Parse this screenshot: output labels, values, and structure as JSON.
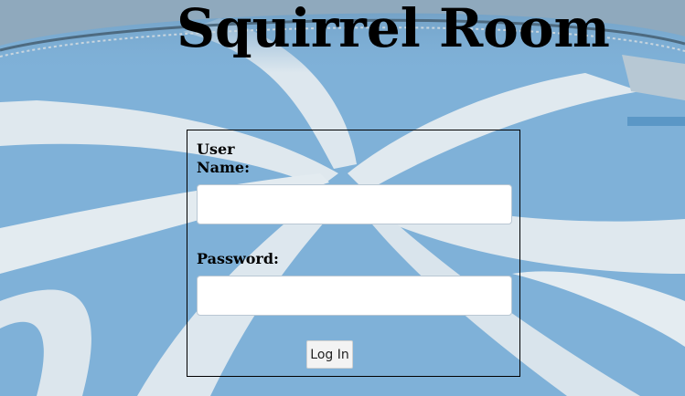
{
  "page": {
    "title": "Squirrel Room"
  },
  "login": {
    "username_label": "User Name:",
    "username_value": "",
    "password_label": "Password:",
    "password_value": "",
    "submit_label": "Log In"
  },
  "colors": {
    "sky_blue": "#7fb0d6",
    "swirl_white": "#dfe8ee",
    "text": "#000000"
  }
}
